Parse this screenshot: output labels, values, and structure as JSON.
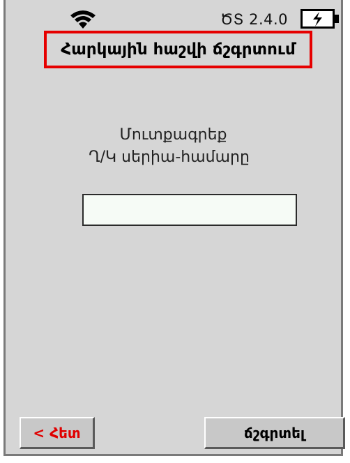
{
  "status_bar": {
    "wifi_icon": "wifi-icon",
    "version": "ԾՏ 2.4.0",
    "battery_icon": "battery-charging-icon"
  },
  "screen": {
    "title": "Հարկային հաշվի ճշգրտում",
    "prompt_line1": "Մուտքագրեք",
    "prompt_line2": "Ղ/Կ սերիա-համարը",
    "serial_input_value": ""
  },
  "buttons": {
    "back_label": "< Հետ",
    "decrypt_label": "ճշգրտել"
  },
  "colors": {
    "title_border": "#e60000",
    "back_label": "#e00000",
    "screen_bg": "#d6d6d6"
  }
}
